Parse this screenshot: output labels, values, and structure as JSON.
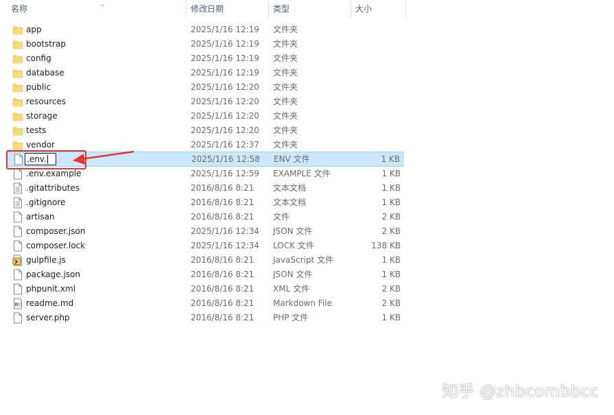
{
  "columns": {
    "name": "名称",
    "date": "修改日期",
    "type": "类型",
    "size": "大小"
  },
  "rename_value": ".env.",
  "files": [
    {
      "name": "app",
      "date": "2025/1/16 12:19",
      "type": "文件夹",
      "size": "",
      "icon": "folder-icon"
    },
    {
      "name": "bootstrap",
      "date": "2025/1/16 12:19",
      "type": "文件夹",
      "size": "",
      "icon": "folder-icon"
    },
    {
      "name": "config",
      "date": "2025/1/16 12:19",
      "type": "文件夹",
      "size": "",
      "icon": "folder-icon"
    },
    {
      "name": "database",
      "date": "2025/1/16 12:19",
      "type": "文件夹",
      "size": "",
      "icon": "folder-icon"
    },
    {
      "name": "public",
      "date": "2025/1/16 12:20",
      "type": "文件夹",
      "size": "",
      "icon": "folder-icon"
    },
    {
      "name": "resources",
      "date": "2025/1/16 12:20",
      "type": "文件夹",
      "size": "",
      "icon": "folder-icon"
    },
    {
      "name": "storage",
      "date": "2025/1/16 12:20",
      "type": "文件夹",
      "size": "",
      "icon": "folder-icon"
    },
    {
      "name": "tests",
      "date": "2025/1/16 12:20",
      "type": "文件夹",
      "size": "",
      "icon": "folder-icon"
    },
    {
      "name": "vendor",
      "date": "2025/1/16 12:37",
      "type": "文件夹",
      "size": "",
      "icon": "folder-icon"
    },
    {
      "name": ".env.",
      "date": "2025/1/16 12:58",
      "type": "ENV 文件",
      "size": "1 KB",
      "icon": "file-icon",
      "renaming": true
    },
    {
      "name": ".env.example",
      "date": "2025/1/16 12:59",
      "type": "EXAMPLE 文件",
      "size": "1 KB",
      "icon": "file-icon"
    },
    {
      "name": ".gitattributes",
      "date": "2016/8/16 8:21",
      "type": "文本文档",
      "size": "1 KB",
      "icon": "text-file-icon"
    },
    {
      "name": ".gitignore",
      "date": "2016/8/16 8:21",
      "type": "文本文档",
      "size": "1 KB",
      "icon": "text-file-icon"
    },
    {
      "name": "artisan",
      "date": "2016/8/16 8:21",
      "type": "文件",
      "size": "2 KB",
      "icon": "file-icon"
    },
    {
      "name": "composer.json",
      "date": "2025/1/16 12:34",
      "type": "JSON 文件",
      "size": "2 KB",
      "icon": "file-icon"
    },
    {
      "name": "composer.lock",
      "date": "2025/1/16 12:34",
      "type": "LOCK 文件",
      "size": "138 KB",
      "icon": "file-icon"
    },
    {
      "name": "gulpfile.js",
      "date": "2016/8/16 8:21",
      "type": "JavaScript 文件",
      "size": "1 KB",
      "icon": "script-file-icon"
    },
    {
      "name": "package.json",
      "date": "2016/8/16 8:21",
      "type": "JSON 文件",
      "size": "1 KB",
      "icon": "file-icon"
    },
    {
      "name": "phpunit.xml",
      "date": "2016/8/16 8:21",
      "type": "XML 文件",
      "size": "2 KB",
      "icon": "file-icon"
    },
    {
      "name": "readme.md",
      "date": "2016/8/16 8:21",
      "type": "Markdown File",
      "size": "2 KB",
      "icon": "markdown-file-icon"
    },
    {
      "name": "server.php",
      "date": "2016/8/16 8:21",
      "type": "PHP 文件",
      "size": "1 KB",
      "icon": "file-icon"
    }
  ],
  "annotation_color": "#e8342f",
  "watermark": "知乎 @zhbcombbcc"
}
